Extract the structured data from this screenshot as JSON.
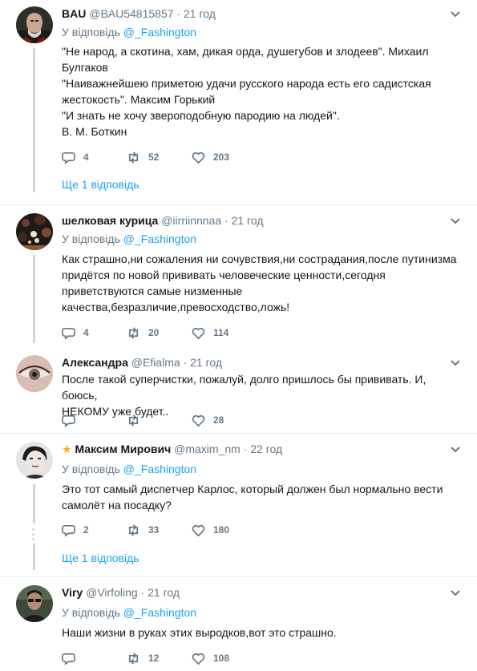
{
  "tweets": [
    {
      "name": "BAU",
      "handle": "@BAU54815857",
      "dot": "·",
      "time": "21 год",
      "reply_prefix": "У відповідь",
      "reply_mention": "@_Fashington",
      "text_lines": [
        "\"Не народ, а скотина, хам, дикая орда, душегубов и злодеев\". Михаил",
        "Булгаков",
        "\"Наиважнейшею приметою удачи русского народа есть его садистская",
        "жестокость\". Максим Горький",
        "\"И знать не хочу звероподобную пародию на людей\".",
        "В. М. Боткин"
      ],
      "replies": "4",
      "retweets": "52",
      "likes": "203",
      "more_replies": "Ще 1 відповідь"
    },
    {
      "name": "шелковая курица",
      "handle": "@iirriinnnaa",
      "dot": "·",
      "time": "21 год",
      "reply_prefix": "У відповідь",
      "reply_mention": "@_Fashington",
      "text_lines": [
        "Как страшно,ни сожаления ни сочувствия,ни сострадания,после путинизма",
        "придётся по новой прививать человеческие ценности,сегодня",
        "приветствуются самые низменные",
        "качества,безразличие,превосходство,ложь!"
      ],
      "replies": "4",
      "retweets": "20",
      "likes": "114"
    },
    {
      "name": "Александра",
      "handle": "@Efialma",
      "dot": "·",
      "time": "21 год",
      "text_lines": [
        "После такой суперчистки, пожалуй, долго пришлось бы прививать. И, боюсь,",
        "НЕКОМУ уже будет.."
      ],
      "replies": "",
      "retweets": "",
      "likes": "28"
    },
    {
      "name_star": "★",
      "name": "Максим Мирович",
      "handle": "@maxim_nm",
      "dot": "·",
      "time": "22 год",
      "reply_prefix": "У відповідь",
      "reply_mention": "@_Fashington",
      "text_lines": [
        "Это тот самый диспетчер Карлос, который должен был нормально вести",
        "самолёт на посадку?"
      ],
      "replies": "2",
      "retweets": "33",
      "likes": "180",
      "more_replies": "Ще 1 відповідь"
    },
    {
      "name": "Viry",
      "handle": "@Virfoling",
      "dot": "·",
      "time": "21 год",
      "reply_prefix": "У відповідь",
      "reply_mention": "@_Fashington",
      "text_lines": [
        "Наши жизни в руках этих выродков,вот это страшно."
      ],
      "replies": "",
      "retweets": "12",
      "likes": "108"
    }
  ],
  "colors": {
    "link": "#1da1f2",
    "muted": "#657786",
    "text": "#14171a",
    "divider": "#e6ecf0",
    "thread": "#ccd6dd"
  },
  "icons": {
    "reply": "reply-icon",
    "retweet": "retweet-icon",
    "like": "heart-icon",
    "menu": "chevron-down-icon"
  }
}
